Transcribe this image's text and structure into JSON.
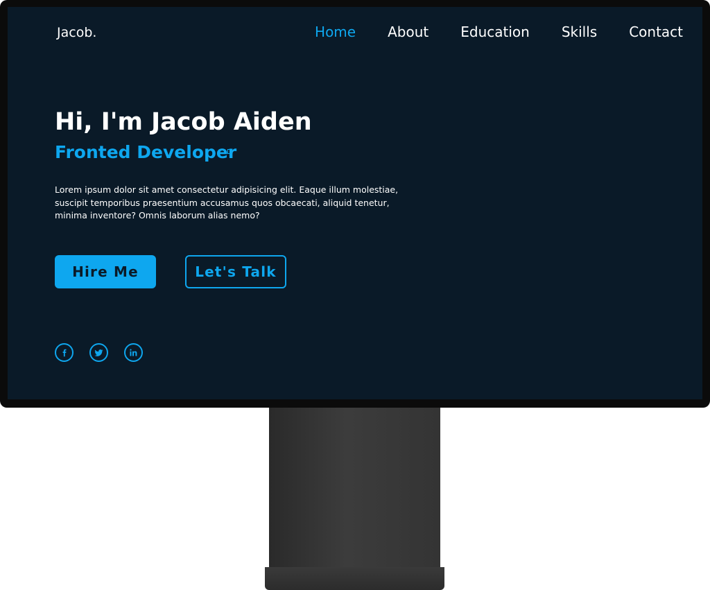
{
  "nav": {
    "logo": "Jacob.",
    "items": [
      {
        "label": "Home",
        "active": true
      },
      {
        "label": "About",
        "active": false
      },
      {
        "label": "Education",
        "active": false
      },
      {
        "label": "Skills",
        "active": false
      },
      {
        "label": "Contact",
        "active": false
      }
    ]
  },
  "hero": {
    "title": "Hi, I'm Jacob Aiden",
    "subtitle": "Fronted Developer",
    "description": "Lorem ipsum dolor sit amet consectetur adipisicing elit. Eaque illum molestiae, suscipit temporibus praesentium accusamus quos obcaecati, aliquid tenetur, minima inventore? Omnis laborum alias nemo?",
    "primary_button": "Hire Me",
    "secondary_button": "Let's Talk"
  },
  "social": [
    {
      "icon": "facebook-icon"
    },
    {
      "icon": "twitter-icon"
    },
    {
      "icon": "linkedin-icon"
    }
  ],
  "colors": {
    "accent": "#0ea7ef",
    "background": "#0a1a28",
    "text": "#ffffff"
  }
}
